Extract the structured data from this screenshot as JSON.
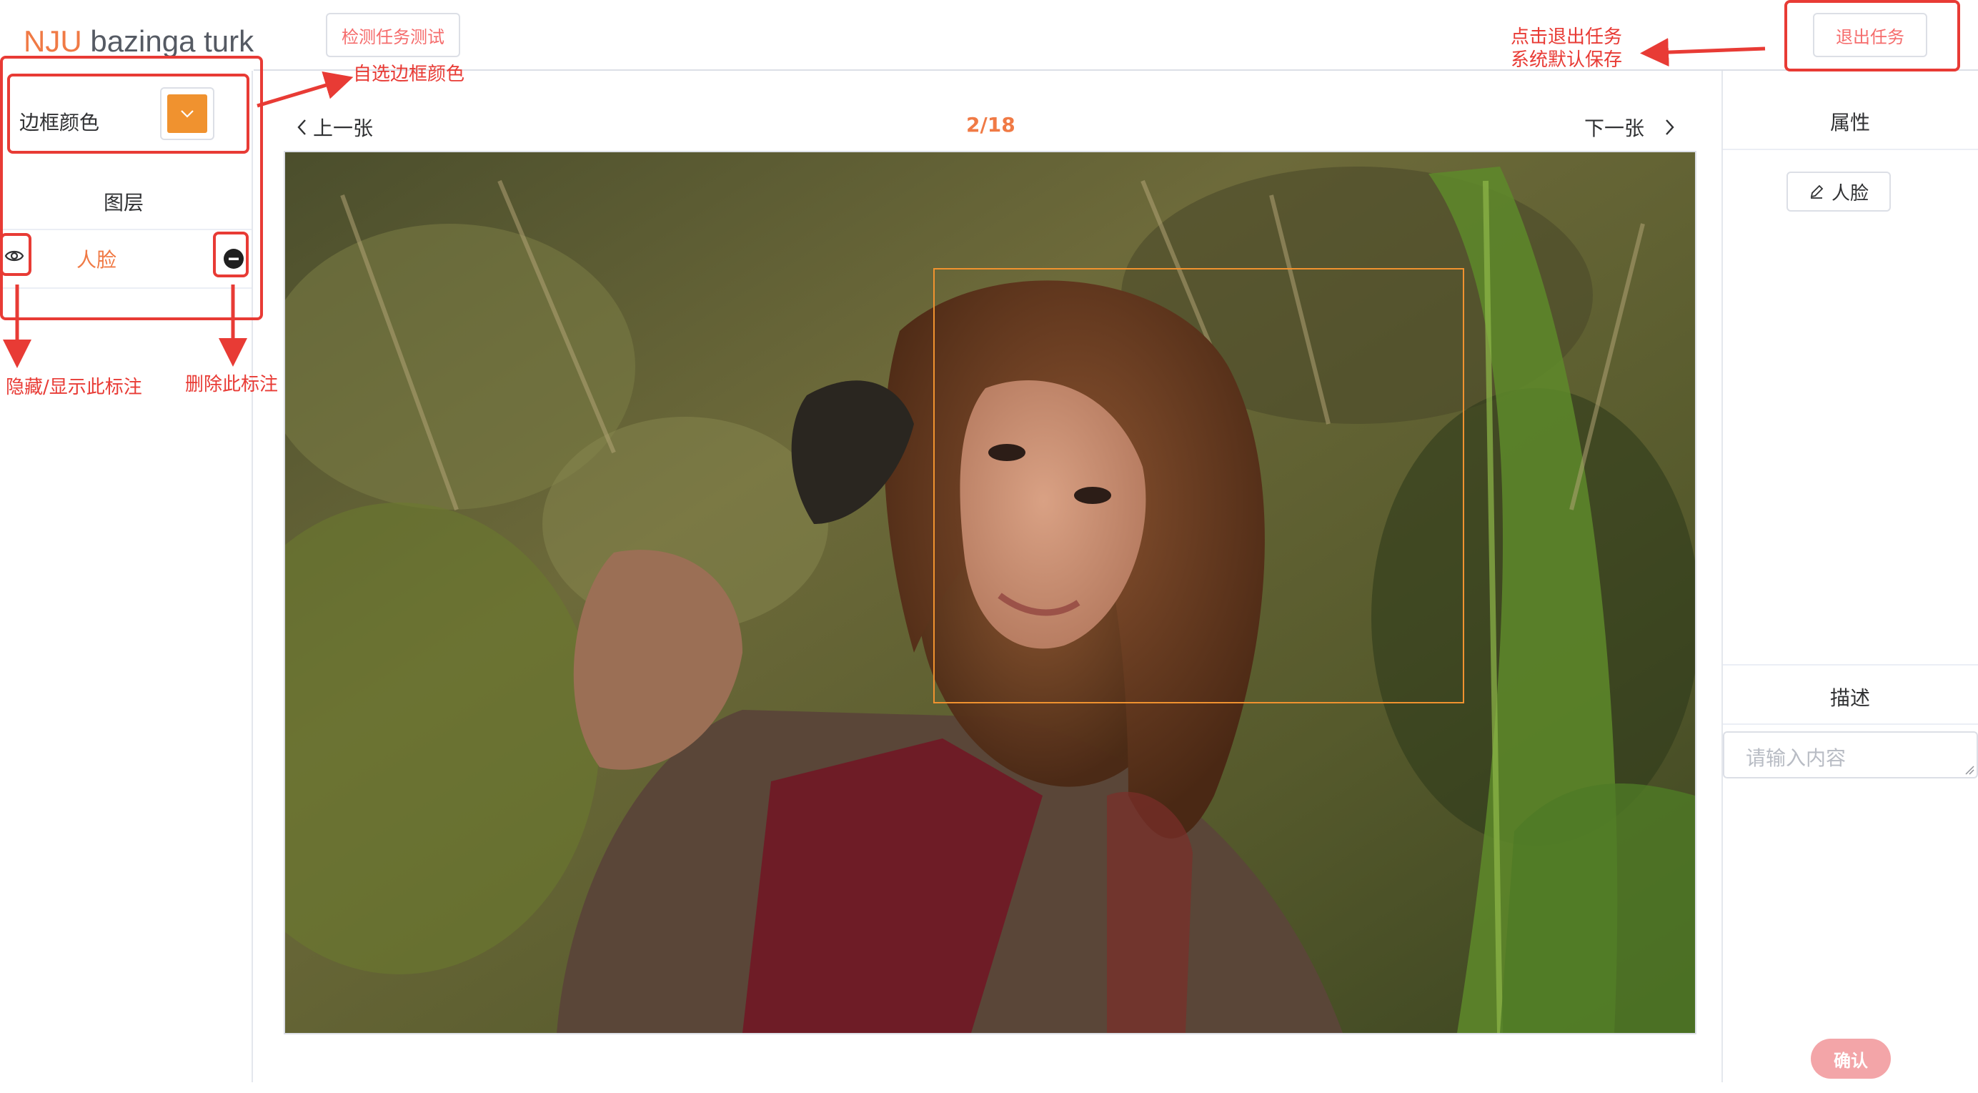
{
  "header": {
    "logo_prefix": "NJU",
    "logo_suffix": " bazinga turk",
    "test_button_label": "检测任务测试",
    "exit_button_label": "退出任务"
  },
  "left_panel": {
    "border_color_label": "边框颜色",
    "border_color_value": "#f0922f",
    "layers_title": "图层",
    "layers": [
      {
        "name": "人脸",
        "visible": true
      }
    ]
  },
  "navigator": {
    "prev_label": "上一张",
    "next_label": "下一张",
    "counter": "2/18"
  },
  "canvas": {
    "image_description": "Woman with long brown hair in jungle foliage",
    "annotations": [
      {
        "label": "人脸",
        "color": "#f0922f"
      }
    ]
  },
  "right_panel": {
    "attributes_title": "属性",
    "attribute_tags": [
      "人脸"
    ],
    "description_title": "描述",
    "description_placeholder": "请输入内容",
    "confirm_label": "确认"
  },
  "callouts": {
    "color_picker_note": "自选边框颜色",
    "toggle_note": "隐藏/显示此标注",
    "delete_note": "删除此标注",
    "exit_note_line1": "点击退出任务",
    "exit_note_line2": "系统默认保存",
    "color": "#e83b35"
  },
  "theme": {
    "accent": "#f07a45",
    "annotation_color": "#f0922f",
    "confirm_bg": "#f3a5a8"
  }
}
